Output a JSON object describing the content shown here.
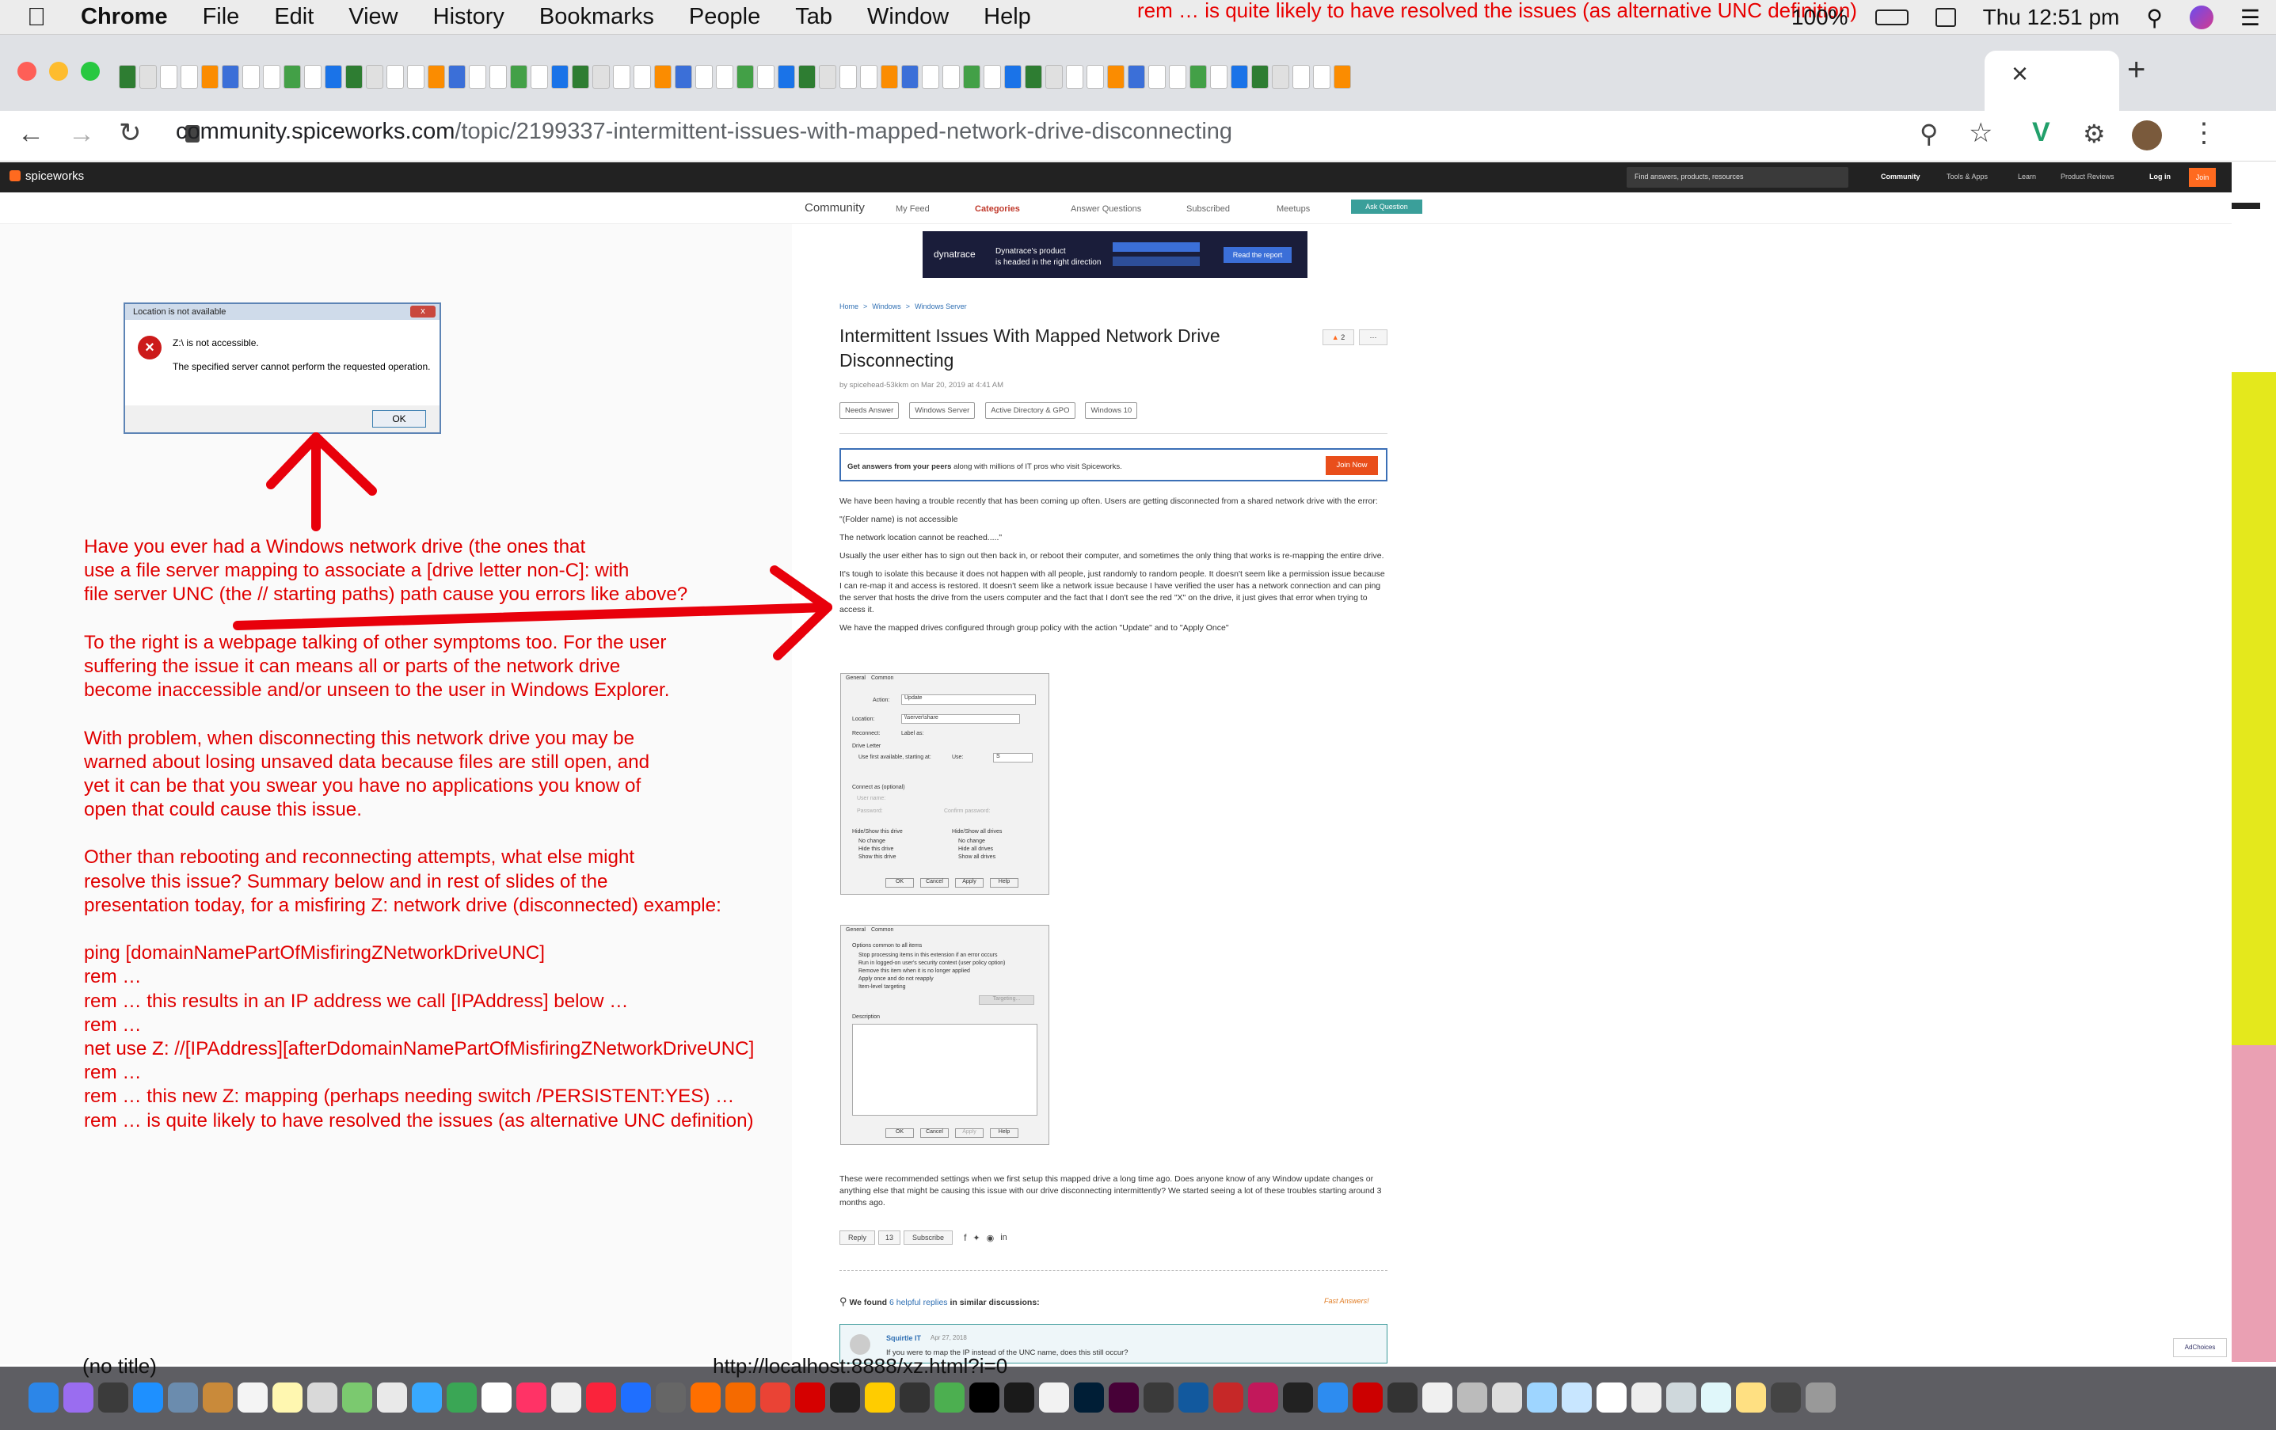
{
  "menubar": {
    "apple": "",
    "app": "Chrome",
    "items": [
      "File",
      "Edit",
      "View",
      "History",
      "Bookmarks",
      "People",
      "Tab",
      "Window",
      "Help"
    ],
    "battery": "100%",
    "clock": "Thu 12:51 pm"
  },
  "overlay_top": "rem … is quite likely to have resolved the issues (as alternative UNC definition)",
  "address": {
    "host": "community.spiceworks.com",
    "path": "/topic/2199337-intermittent-issues-with-mapped-network-drive-disconnecting"
  },
  "tabs": {
    "close": "×",
    "new": "+"
  },
  "spiceworks": {
    "logo": "spiceworks",
    "search": "Find answers, products, resources",
    "nav": [
      "Community",
      "Tools & Apps",
      "Learn",
      "Product Reviews"
    ],
    "login": "Log in",
    "join": "Join"
  },
  "subnav": {
    "items": [
      "Community",
      "My Feed",
      "Categories",
      "Answer Questions",
      "Subscribed",
      "Meetups"
    ],
    "ask": "Ask Question"
  },
  "ad": {
    "brand": "dynatrace",
    "line1": "Dynatrace's product",
    "line2": "is headed in the right direction",
    "cta": "Read the report"
  },
  "dialog": {
    "title": "Location is not available",
    "line1": "Z:\\ is not accessible.",
    "line2": "The specified server cannot perform the requested operation.",
    "ok": "OK"
  },
  "annotation": [
    "Have you ever had a Windows network drive (the ones that",
    "use a file server mapping to associate a [drive letter non-C]: with",
    "file server UNC (the // starting paths) path cause you errors like above?",
    "",
    "To the right is a webpage talking of other symptoms too.  For the user",
    "suffering the issue it can means all or parts of the network drive",
    "become  inaccessible and/or unseen to the user in Windows Explorer.",
    "",
    "With problem, when disconnecting this network drive you may be",
    "warned about losing unsaved data because files are still open, and",
    "yet it can be that you swear you have no applications you know of",
    "open that could cause this issue.",
    "",
    "Other than rebooting and reconnecting attempts, what else might",
    "resolve this issue?  Summary below and in rest of slides of the",
    "presentation today, for a misfiring Z: network drive (disconnected) example:",
    "",
    "ping [domainNamePartOfMisfiringZNetworkDriveUNC]",
    "rem …",
    "rem … this results in an IP address we call [IPAddress] below …",
    "rem …",
    "net use Z: //[IPAddress][afterDdomainNamePartOfMisfiringZNetworkDriveUNC]",
    "rem …",
    "rem … this new Z: mapping (perhaps needing switch /PERSISTENT:YES) …",
    "rem … is quite likely to have resolved the issues (as alternative UNC definition)"
  ],
  "post": {
    "breadcrumb": [
      "Home",
      ">",
      "Windows",
      ">",
      "Windows Server"
    ],
    "title": "Intermittent Issues With Mapped Network Drive Disconnecting",
    "votes": "2",
    "author": "by spicehead-53kkm on Mar 20, 2019 at 4:41 AM",
    "tags": [
      "Needs Answer",
      "Windows Server",
      "Active Directory & GPO",
      "Windows 10"
    ],
    "cta_bold": "Get answers from your peers",
    "cta_rest": " along with millions of IT pros who visit Spiceworks.",
    "cta_btn": "Join Now",
    "paras": [
      "We have been having a trouble recently that has been coming up often. Users are getting disconnected from a shared network drive with the error:",
      "\"(Folder name) is not accessible",
      "The network location cannot be reached.....\"",
      "Usually the user either has to sign out then back in, or reboot their computer, and sometimes the only thing that works is re-mapping the entire drive.",
      "It's tough to isolate this because it does not happen with all people, just randomly to random people. It doesn't seem like a permission issue because I can re-map it and access is restored. It doesn't seem like a network issue because I have verified the user has a network connection and can ping the server that hosts the drive from the users computer and the fact that I don't see the red \"X\" on the drive, it just gives that error when trying to access it.",
      "We have the mapped drives configured through group policy with the action \"Update\" and to \"Apply Once\""
    ],
    "closing": "These were recommended settings when we first setup this mapped drive a long time ago. Does anyone know of any Window update changes or anything else that might be causing this issue with our drive disconnecting intermittently? We started seeing a lot of these troubles starting around 3 months ago.",
    "reply": "Reply",
    "reply_count": "13",
    "subscribe": "Subscribe",
    "found_pre": "We found ",
    "found_link": "6 helpful replies",
    "found_post": " in similar discussions:",
    "fast": "Fast Answers!",
    "related_user": "Squirtle IT",
    "related_date": "Apr 27, 2018",
    "related_q": "If you were to map the IP instead of the UNC name, does this still occur?"
  },
  "shot1": {
    "tabs": [
      "General",
      "Common"
    ],
    "action_label": "Action:",
    "action": "Update",
    "location": "Location:",
    "location_val": "\\\\server\\share",
    "reconnect": "Reconnect:",
    "label_as": "Label as:",
    "drive_letter": "Drive Letter",
    "use_first": "Use first available, starting at:",
    "use": "Use:",
    "letter": "S",
    "connect_as": "Connect as (optional)",
    "user": "User name:",
    "pass": "Password:",
    "confirm": "Confirm password:",
    "hide_this": "Hide/Show this drive",
    "hide_all": "Hide/Show all drives",
    "opt_a": [
      "No change",
      "Hide this drive",
      "Show this drive"
    ],
    "opt_b": [
      "No change",
      "Hide all drives",
      "Show all drives"
    ],
    "buttons": [
      "OK",
      "Cancel",
      "Apply",
      "Help"
    ]
  },
  "shot2": {
    "tabs": [
      "General",
      "Common"
    ],
    "heading": "Options common to all items",
    "opts": [
      "Stop processing items in this extension if an error occurs",
      "Run in logged-on user's security context (user policy option)",
      "Remove this item when it is no longer applied",
      "Apply once and do not reapply",
      "Item-level targeting"
    ],
    "targeting": "Targeting...",
    "desc": "Description",
    "buttons": [
      "OK",
      "Cancel",
      "Apply",
      "Help"
    ]
  },
  "taskbar": {
    "notitle": "(no title)",
    "localhost": "http://localhost:8888/xz.html?i=0"
  },
  "adchoices": "AdChoices"
}
